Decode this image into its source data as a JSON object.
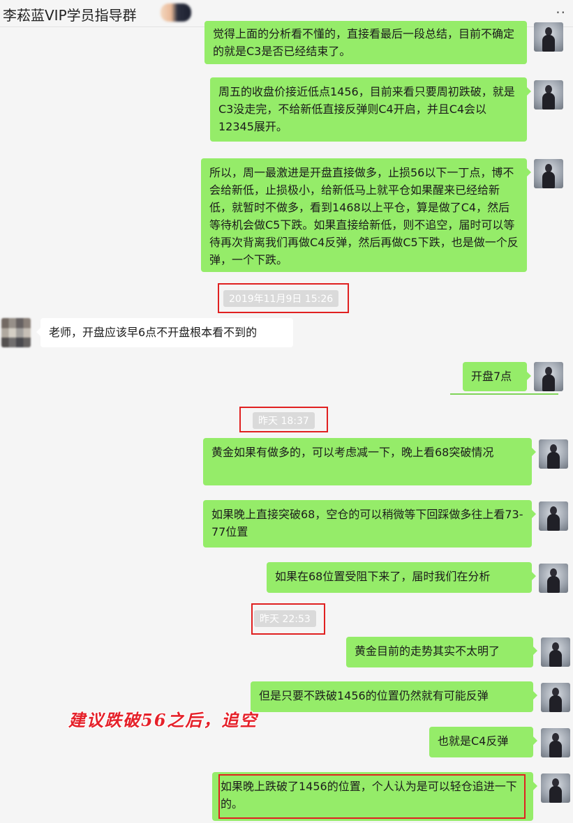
{
  "header": {
    "title": "李菘蓝VIP学员指导群",
    "more_label": "··"
  },
  "messages": [
    {
      "side": "right",
      "text": "觉得上面的分析看不懂的，直接看最后一段总结，目前不确定的就是C3是否已经结束了。"
    },
    {
      "side": "right",
      "text": "周五的收盘价接近低点1456，目前来看只要周初跌破，就是C3没走完，不给新低直接反弹则C4开启，并且C4会以12345展开。"
    },
    {
      "side": "right",
      "text": "所以，周一最激进是开盘直接做多，止损56以下一丁点，博不会给新低，止损极小，给新低马上就平仓如果醒来已经给新低，就暂时不做多，看到1468以上平仓，算是做了C4，然后等待机会做C5下跌。如果直接给新低，则不追空，届时可以等待再次背离我们再做C4反弹，然后再做C5下跌，也是做一个反弹，一个下跌。"
    },
    {
      "side": "time",
      "text": "2019年11月9日 15:26"
    },
    {
      "side": "left",
      "text": "老师，开盘应该早6点不开盘根本看不到的"
    },
    {
      "side": "right",
      "text": "开盘7点"
    },
    {
      "side": "time",
      "text": "昨天 18:37"
    },
    {
      "side": "right",
      "text": "黄金如果有做多的，可以考虑减一下，晚上看68突破情况"
    },
    {
      "side": "right",
      "text": "如果晚上直接突破68，空仓的可以稍微等下回踩做多往上看73-77位置"
    },
    {
      "side": "right",
      "text": "如果在68位置受阻下来了，届时我们在分析"
    },
    {
      "side": "time",
      "text": "昨天 22:53"
    },
    {
      "side": "right",
      "text": "黄金目前的走势其实不太明了"
    },
    {
      "side": "right",
      "text": "但是只要不跌破1456的位置仍然就有可能反弹"
    },
    {
      "side": "right",
      "text": "也就是C4反弹"
    },
    {
      "side": "right",
      "text": "如果晚上跌破了1456的位置，个人认为是可以轻仓追进一下的。"
    }
  ],
  "annotation": "建议跌破56之后，追空",
  "colors": {
    "bubble_self": "#95ec69",
    "bubble_other": "#ffffff",
    "highlight_border": "#e02020",
    "annotation_text": "#e5212a"
  },
  "icons": {
    "more": "more-icon",
    "avatar_self": "avatar-teacher",
    "avatar_other": "avatar-student-blurred"
  }
}
